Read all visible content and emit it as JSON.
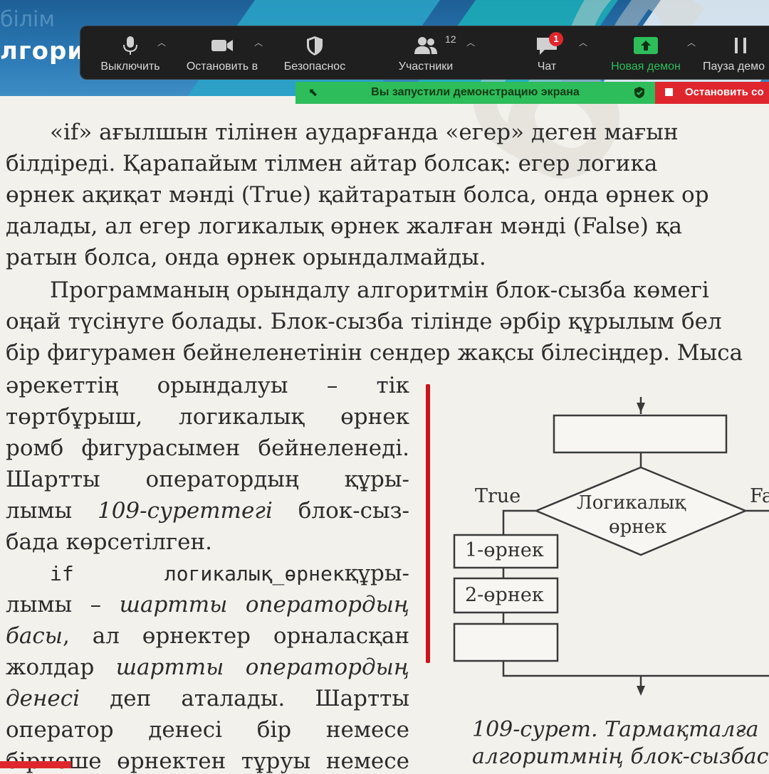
{
  "background": {
    "title_fragment": "лгори",
    "ghost_fragment": "білім"
  },
  "toolbar": {
    "mute_label": "Выключить",
    "video_label": "Остановить в",
    "security_label": "Безопаснос",
    "participants_label": "Участники",
    "participants_count": "12",
    "chat_label": "Чат",
    "chat_badge": "1",
    "share_label": "Новая демон",
    "pause_label": "Пауза демо"
  },
  "sharebar": {
    "text": "Вы запустили демонстрацию экрана",
    "stop_label": "Остановить со"
  },
  "page": {
    "lines": [
      "«if»  ағылшын тілінен аударғанда «егер» деген мағын",
      "білдіреді. Қарапайым тілмен айтар болсақ: егер логика",
      "өрнек ақиқат мәнді (True) қайтаратын болса, онда өрнек ор",
      "далады, ал егер логикалық өрнек жалған мәнді (False) қа",
      "ратын болса, онда өрнек орындалмайды.",
      "Программаның орындалу алгоритмін блок-сызба көмегі",
      "оңай түсінуге болады. Блок-сызба тілінде әрбір құрылым бел",
      "бір фигурамен бейнеленетінін сендер жақсы білесіңдер. Мыса"
    ],
    "left_col": {
      "l1": "әрекеттің  орындалуы  –  тік",
      "l2": "төртбұрыш,  логикалық  өрнек",
      "l3": "ромб фигурасымен бейнеленеді.",
      "l4": "Шартты  оператордың  құры-",
      "l5a": "лымы ",
      "l5b": "109-суреттегі",
      "l5c": " блок-сыз-",
      "l6": "бада көрсетілген.",
      "l7a": "if логикалық_өрнек",
      "l7b": "құры-",
      "l8a": "лымы – ",
      "l8b": "шартты оператордың",
      "l9a": "басы",
      "l9b": ", ал өрнектер орналасқан",
      "l10a": "жолдар ",
      "l10b": "шартты оператордың",
      "l11a": "денесі",
      "l11b": "  деп  аталады.  Шартты",
      "l12": "оператор  денесі  бір  немесе",
      "l13": "бірнеше өрнектен тұруы немесе"
    }
  },
  "flowchart": {
    "true_label": "True",
    "false_label": "Fa",
    "diamond_line1": "Логикалық",
    "diamond_line2": "өрнек",
    "box1": "1-өрнек",
    "box2": "2-өрнек",
    "caption_line1": "109-сурет. Тармақталға",
    "caption_line2": "алгоритмнің блок-сызбас"
  },
  "watermark": "баспа"
}
